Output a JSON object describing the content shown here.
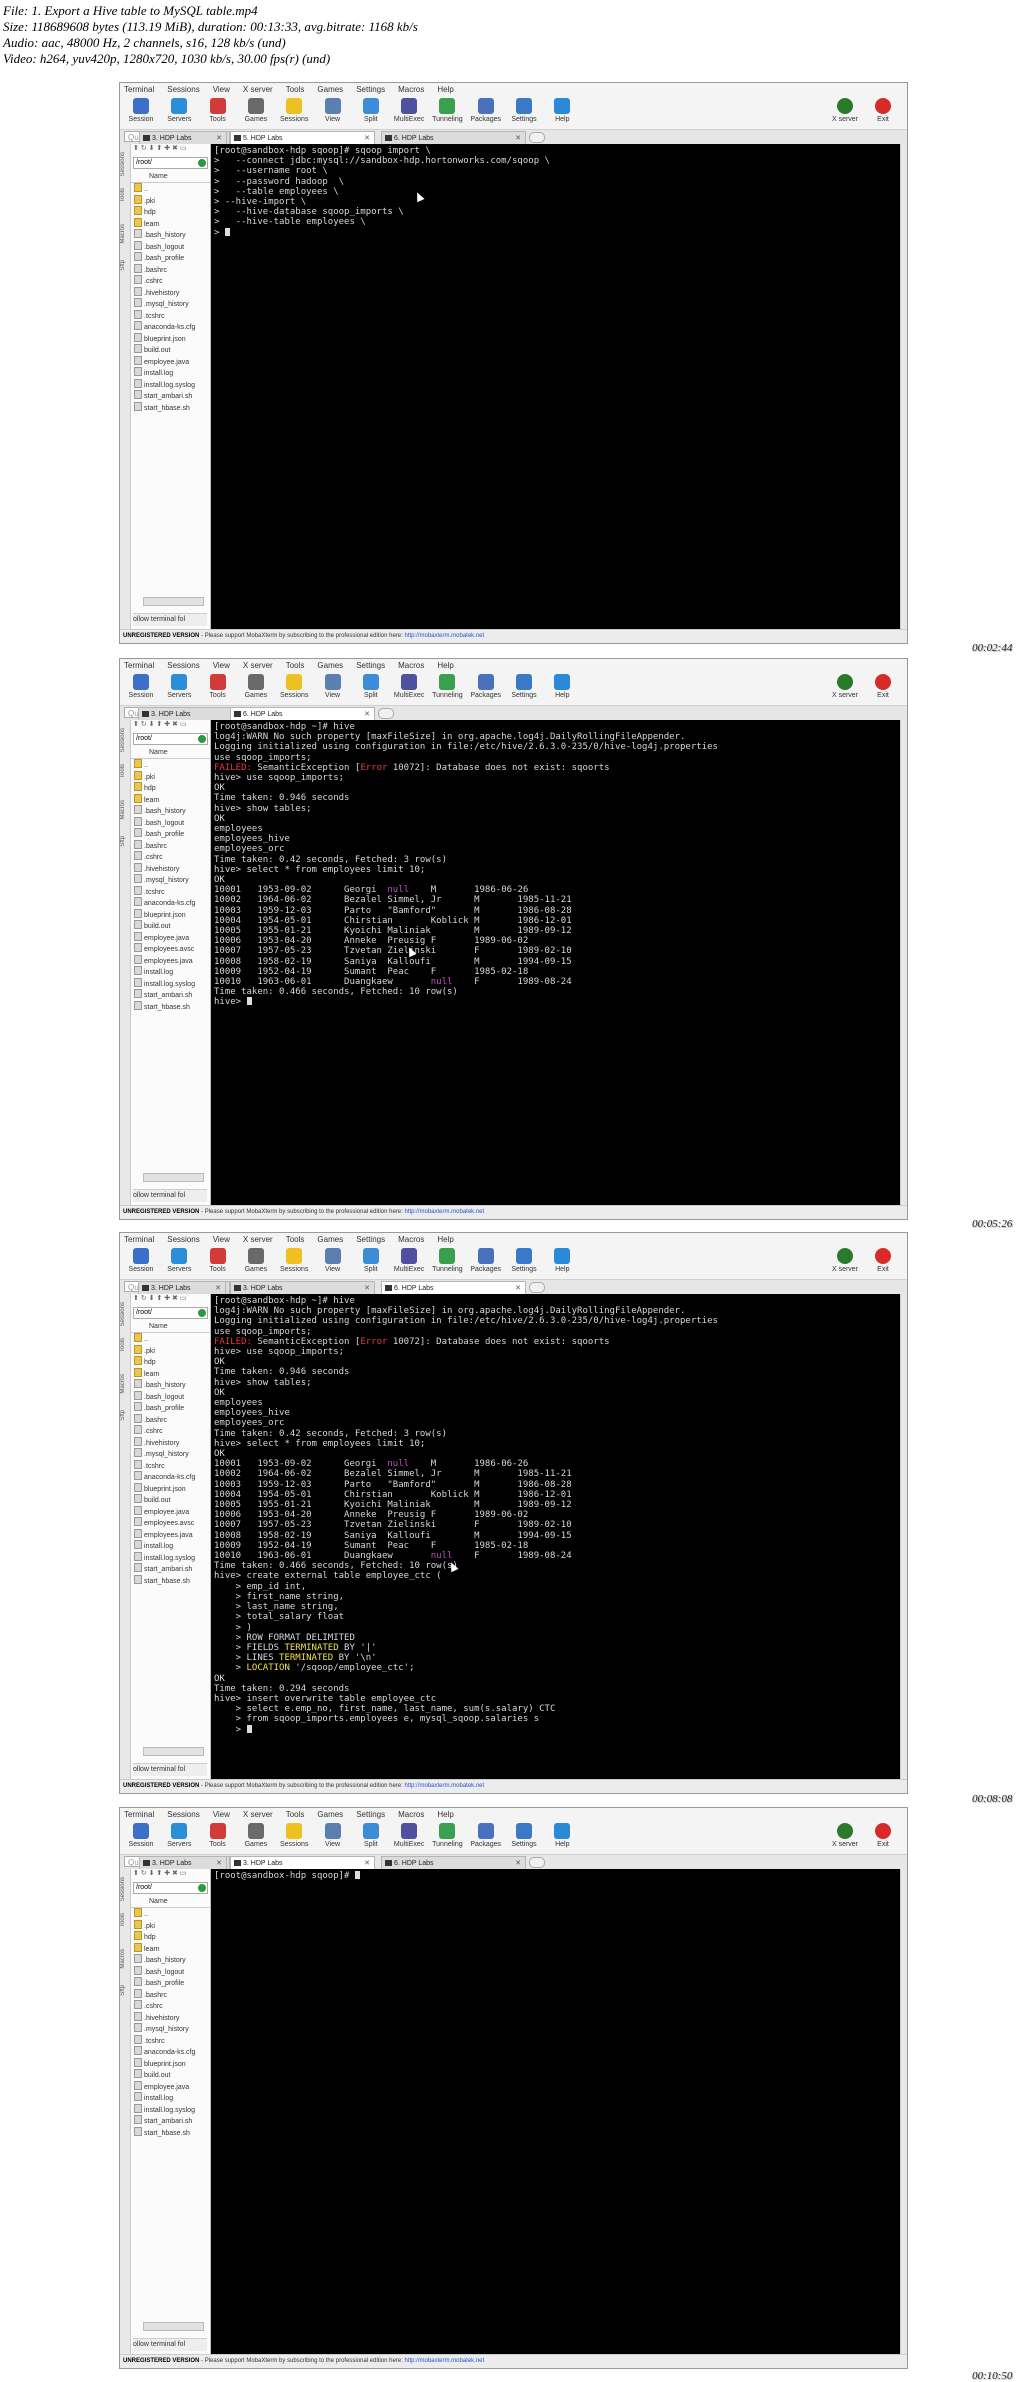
{
  "header": {
    "line1": "File: 1. Export a Hive table to MySQL table.mp4",
    "line2": "Size: 118689608 bytes (113.19 MiB), duration: 00:13:33, avg.bitrate: 1168 kb/s",
    "line3": "Audio: aac, 48000 Hz, 2 channels, s16, 128 kb/s (und)",
    "line4": "Video: h264, yuv420p, 1280x720, 1030 kb/s, 30.00 fps(r) (und)"
  },
  "menu": [
    "Terminal",
    "Sessions",
    "View",
    "X server",
    "Tools",
    "Games",
    "Settings",
    "Macros",
    "Help"
  ],
  "toolbar": [
    {
      "label": "Session",
      "icon": "session-icon",
      "color": "#3b6fc9"
    },
    {
      "label": "Servers",
      "icon": "servers-icon",
      "color": "#2a8fd8"
    },
    {
      "label": "Tools",
      "icon": "tools-icon",
      "color": "#d33a3a"
    },
    {
      "label": "Games",
      "icon": "games-icon",
      "color": "#6a6a6a"
    },
    {
      "label": "Sessions",
      "icon": "sessions-star-icon",
      "color": "#f0c020"
    },
    {
      "label": "View",
      "icon": "view-icon",
      "color": "#5a7fb0"
    },
    {
      "label": "Split",
      "icon": "split-icon",
      "color": "#3b8dd8"
    },
    {
      "label": "MultiExec",
      "icon": "multiexec-icon",
      "color": "#5050a0"
    },
    {
      "label": "Tunneling",
      "icon": "tunneling-icon",
      "color": "#3aa050"
    },
    {
      "label": "Packages",
      "icon": "packages-icon",
      "color": "#4a70c0"
    },
    {
      "label": "Settings",
      "icon": "settings-icon",
      "color": "#3a78c8"
    },
    {
      "label": "Help",
      "icon": "help-icon",
      "color": "#2a8ad8"
    }
  ],
  "toolbar_right": [
    {
      "label": "X server",
      "icon": "x-server-icon",
      "color": "#2a7a2a"
    },
    {
      "label": "Exit",
      "icon": "exit-icon",
      "color": "#d92a2a"
    }
  ],
  "quick_connect": "Quick connect...",
  "vertical_tabs": [
    "Sessions",
    "Tools",
    "Macros",
    "Sftp"
  ],
  "sidebar": {
    "path": "/root/",
    "column": "Name",
    "follow": "ollow terminal fol"
  },
  "status": {
    "label": "UNREGISTERED VERSION",
    "message": " -  Please support MobaXterm by subscribing to the professional edition here: ",
    "link": "http://mobaxterm.mobatek.net"
  },
  "frames": [
    {
      "timestamp": "00:02:44",
      "tabs": [
        {
          "label": "3. HDP Labs",
          "active": false
        },
        {
          "label": "5. HDP Labs",
          "active": true
        },
        {
          "label": "6. HDP Labs",
          "active": false
        }
      ],
      "files": [
        "..",
        ".pki",
        "hdp",
        "learn",
        ".bash_history",
        ".bash_logout",
        ".bash_profile",
        ".bashrc",
        ".cshrc",
        ".hivehistory",
        ".mysql_history",
        ".tcshrc",
        "anaconda-ks.cfg",
        "blueprint.json",
        "build.out",
        "employee.java",
        "install.log",
        "install.log.syslog",
        "start_ambari.sh",
        "start_hbase.sh"
      ],
      "lines": [
        "[root@sandbox-hdp sqoop]# sqoop import \\",
        ">   --connect jdbc:mysql://sandbox-hdp.hortonworks.com/sqoop \\",
        ">   --username root \\",
        ">   --password hadoop  \\",
        ">   --table employees \\",
        "> --hive-import \\",
        ">   --hive-database sqoop_imports \\",
        ">   --hive-table employees \\",
        ">"
      ]
    },
    {
      "timestamp": "00:05:26",
      "tabs": [
        {
          "label": "3. HDP Labs",
          "active": false
        },
        {
          "label": "6. HDP Labs",
          "active": true
        }
      ],
      "files": [
        "..",
        ".pki",
        "hdp",
        "learn",
        ".bash_history",
        ".bash_logout",
        ".bash_profile",
        ".bashrc",
        ".cshrc",
        ".hivehistory",
        ".mysql_history",
        ".tcshrc",
        "anaconda-ks.cfg",
        "blueprint.json",
        "build.out",
        "employee.java",
        "employees.avsc",
        "employees.java",
        "install.log",
        "install.log.syslog",
        "start_ambari.sh",
        "start_hbase.sh"
      ],
      "lines": [
        "[root@sandbox-hdp ~]# hive",
        "log4j:WARN No such property [maxFileSize] in org.apache.log4j.DailyRollingFileAppender.",
        "",
        "Logging initialized using configuration in file:/etc/hive/2.6.3.0-235/0/hive-log4j.properties",
        "use sqoop_imports;",
        "FAILED: SemanticException [Error 10072]: Database does not exist: sqoorts",
        "hive> use sqoop_imports;",
        "OK",
        "Time taken: 0.946 seconds",
        "hive> show tables;",
        "OK",
        "employees",
        "employees_hive",
        "employees_orc",
        "Time taken: 0.42 seconds, Fetched: 3 row(s)",
        "hive> select * from employees limit 10;",
        "OK",
        "10001   1953-09-02      Georgi  null    M       1986-06-26",
        "10002   1964-06-02      Bezalel Simmel, Jr      M       1985-11-21",
        "10003   1959-12-03      Parto   \"Bamford\"       M       1986-08-28",
        "10004   1954-05-01      Chirstian       Koblick M       1986-12-01",
        "10005   1955-01-21      Kyoichi Maliniak        M       1989-09-12",
        "10006   1953-04-20      Anneke  Preusig F       1989-06-02",
        "10007   1957-05-23      Tzvetan Zielinski       F       1989-02-10",
        "10008   1958-02-19      Saniya  Kalloufi        M       1994-09-15",
        "10009   1952-04-19      Sumant  Peac    F       1985-02-18",
        "10010   1963-06-01      Duangkaew       null    F       1989-08-24",
        "Time taken: 0.466 seconds, Fetched: 10 row(s)",
        "hive>"
      ]
    },
    {
      "timestamp": "00:08:08",
      "tabs": [
        {
          "label": "3. HDP Labs",
          "active": false
        },
        {
          "label": "3. HDP Labs",
          "active": false
        },
        {
          "label": "6. HDP Labs",
          "active": true
        }
      ],
      "files": [
        "..",
        ".pki",
        "hdp",
        "learn",
        ".bash_history",
        ".bash_logout",
        ".bash_profile",
        ".bashrc",
        ".cshrc",
        ".hivehistory",
        ".mysql_history",
        ".tcshrc",
        "anaconda-ks.cfg",
        "blueprint.json",
        "build.out",
        "employee.java",
        "employees.avsc",
        "employees.java",
        "install.log",
        "install.log.syslog",
        "start_ambari.sh",
        "start_hbase.sh"
      ],
      "lines": [
        "[root@sandbox-hdp ~]# hive",
        "log4j:WARN No such property [maxFileSize] in org.apache.log4j.DailyRollingFileAppender.",
        "",
        "Logging initialized using configuration in file:/etc/hive/2.6.3.0-235/0/hive-log4j.properties",
        "use sqoop_imports;",
        "FAILED: SemanticException [Error 10072]: Database does not exist: sqoorts",
        "hive> use sqoop_imports;",
        "OK",
        "Time taken: 0.946 seconds",
        "hive> show tables;",
        "OK",
        "employees",
        "employees_hive",
        "employees_orc",
        "Time taken: 0.42 seconds, Fetched: 3 row(s)",
        "hive> select * from employees limit 10;",
        "OK",
        "10001   1953-09-02      Georgi  null    M       1986-06-26",
        "10002   1964-06-02      Bezalel Simmel, Jr      M       1985-11-21",
        "10003   1959-12-03      Parto   \"Bamford\"       M       1986-08-28",
        "10004   1954-05-01      Chirstian       Koblick M       1986-12-01",
        "10005   1955-01-21      Kyoichi Maliniak        M       1989-09-12",
        "10006   1953-04-20      Anneke  Preusig F       1989-06-02",
        "10007   1957-05-23      Tzvetan Zielinski       F       1989-02-10",
        "10008   1958-02-19      Saniya  Kalloufi        M       1994-09-15",
        "10009   1952-04-19      Sumant  Peac    F       1985-02-18",
        "10010   1963-06-01      Duangkaew       null    F       1989-08-24",
        "Time taken: 0.466 seconds, Fetched: 10 row(s)",
        "hive> create external table employee_ctc (",
        "    > emp_id int,",
        "    > first_name string,",
        "    > last_name string,",
        "    > total_salary float",
        "    > )",
        "    > ROW FORMAT DELIMITED",
        "    > FIELDS TERMINATED BY '|'",
        "    > LINES TERMINATED BY '\\n'",
        "    > LOCATION '/sqoop/employee_ctc';",
        "OK",
        "Time taken: 0.294 seconds",
        "hive> insert overwrite table employee_ctc",
        "    > select e.emp_no, first_name, last_name, sum(s.salary) CTC",
        "    > from sqoop_imports.employees e, mysql_sqoop.salaries s",
        "    >"
      ]
    },
    {
      "timestamp": "00:10:50",
      "tabs": [
        {
          "label": "3. HDP Labs",
          "active": false
        },
        {
          "label": "3. HDP Labs",
          "active": true
        },
        {
          "label": "6. HDP Labs",
          "active": false
        }
      ],
      "files": [
        "..",
        ".pki",
        "hdp",
        "learn",
        ".bash_history",
        ".bash_logout",
        ".bash_profile",
        ".bashrc",
        ".cshrc",
        ".hivehistory",
        ".mysql_history",
        ".tcshrc",
        "anaconda-ks.cfg",
        "blueprint.json",
        "build.out",
        "employee.java",
        "install.log",
        "install.log.syslog",
        "start_ambari.sh",
        "start_hbase.sh"
      ],
      "lines": [
        "[root@sandbox-hdp sqoop]#"
      ]
    }
  ],
  "colors": {
    "error": "#e23a3a",
    "null": "#c052c0",
    "keyword": "#f1e24a",
    "terminal_bg": "#000000",
    "ok_badge": "#2b9a3f"
  }
}
